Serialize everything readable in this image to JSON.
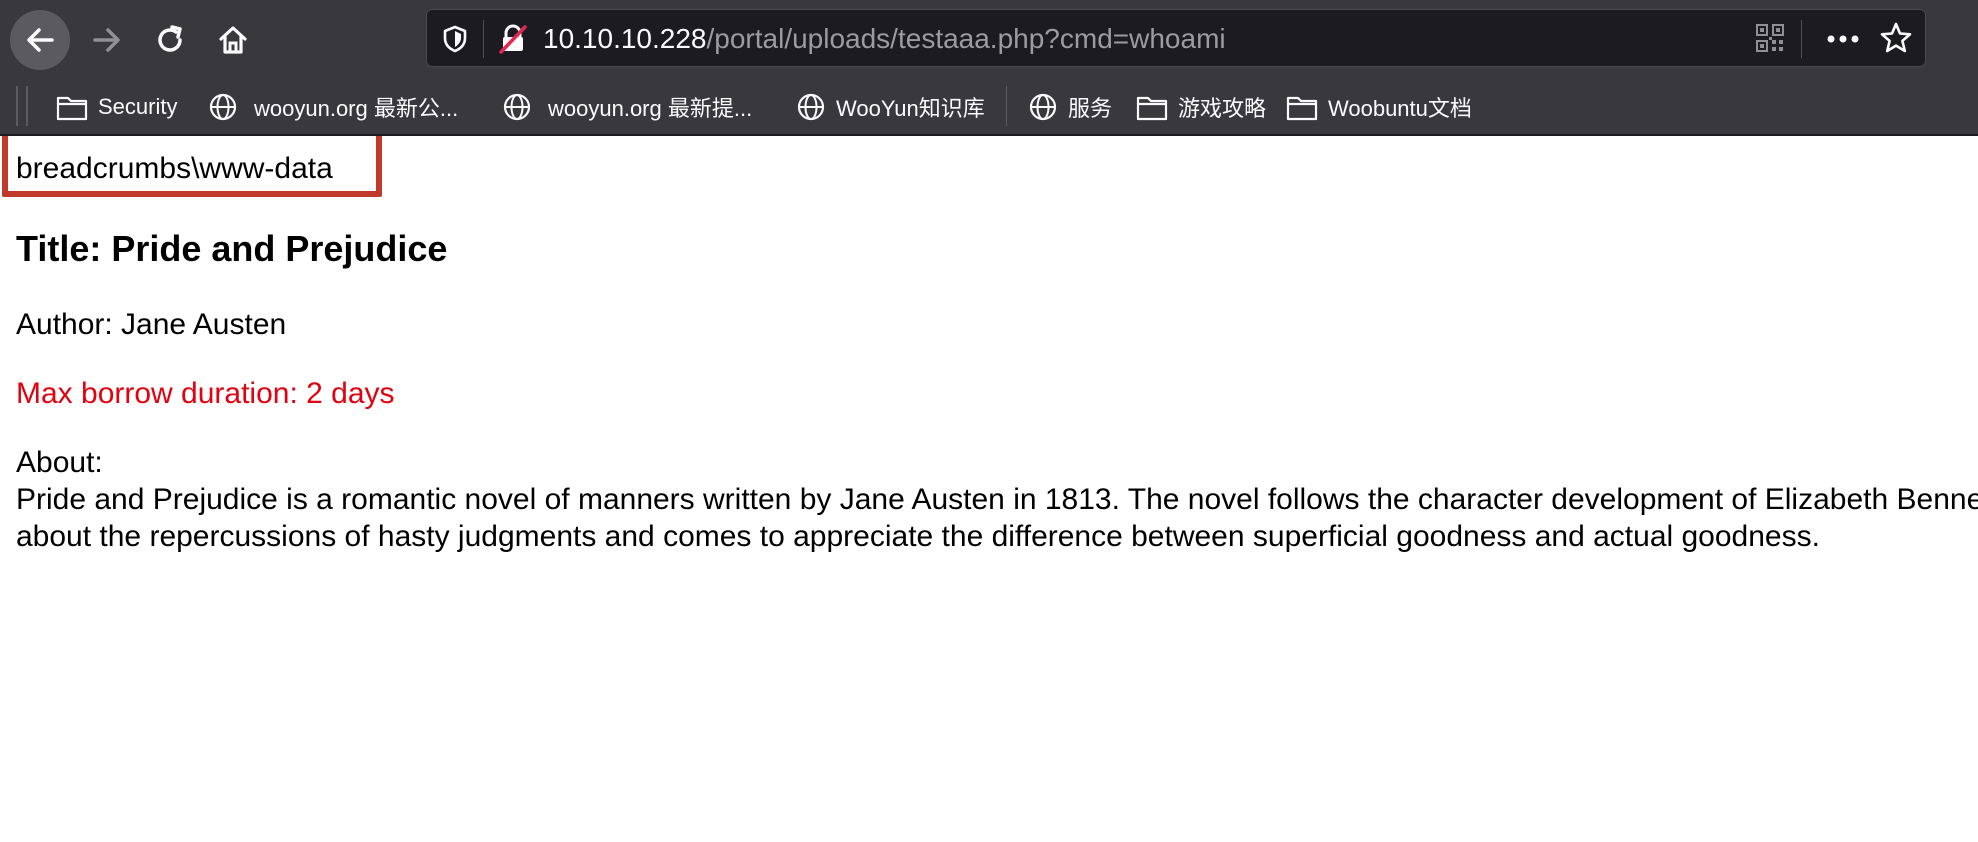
{
  "browser": {
    "url_host": "10.10.10.228",
    "url_path": "/portal/uploads/testaaa.php?cmd=whoami"
  },
  "bookmarks": [
    {
      "label": "Security",
      "icon": "folder-icon"
    },
    {
      "label": "wooyun.org 最新公...",
      "icon": "globe-icon"
    },
    {
      "label": "wooyun.org 最新提...",
      "icon": "globe-icon"
    },
    {
      "label": "WooYun知识库",
      "icon": "globe-icon"
    },
    {
      "label": "服务",
      "icon": "globe-icon"
    },
    {
      "label": "游戏攻略",
      "icon": "folder-icon"
    },
    {
      "label": "Woobuntu文档",
      "icon": "folder-icon"
    }
  ],
  "page": {
    "command_output": "breadcrumbs\\www-data",
    "title": "Title: Pride and Prejudice",
    "author": "Author: Jane Austen",
    "duration": "Max borrow duration: 2 days",
    "about_label": "About:",
    "about_line_1": "Pride and Prejudice is a romantic novel of manners written by Jane Austen in 1813. The novel follows the character development of Elizabeth Bennet, the dynamic protagonist of the book who learns",
    "about_line_2": "about the repercussions of hasty judgments and comes to appreciate the difference between superficial goodness and actual goodness."
  },
  "colors": {
    "highlight_border": "#c0392b",
    "duration_text": "#e3000f",
    "chrome_background": "#38383d"
  }
}
